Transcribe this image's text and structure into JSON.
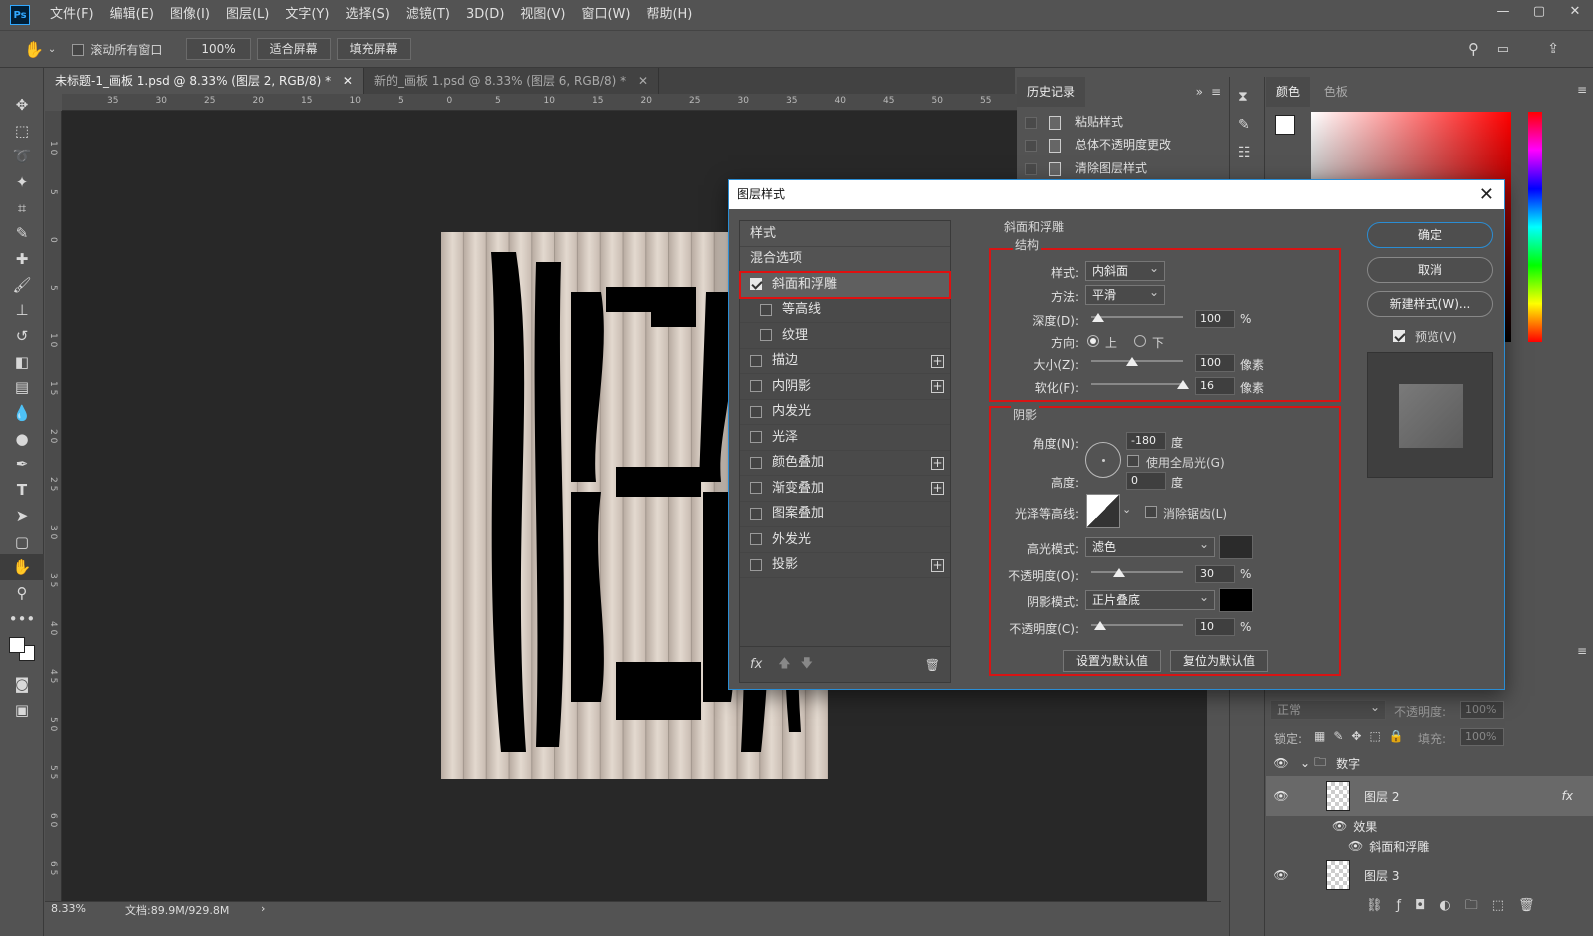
{
  "menubar": {
    "logo": "Ps",
    "items": [
      "文件(F)",
      "编辑(E)",
      "图像(I)",
      "图层(L)",
      "文字(Y)",
      "选择(S)",
      "滤镜(T)",
      "3D(D)",
      "视图(V)",
      "窗口(W)",
      "帮助(H)"
    ]
  },
  "options": {
    "scroll_all": "滚动所有窗口",
    "zoom": "100%",
    "fit_screen": "适合屏幕",
    "fill_screen": "填充屏幕"
  },
  "tabs": [
    {
      "label": "未标题-1_画板 1.psd @ 8.33% (图层 2, RGB/8) *"
    },
    {
      "label": "新的_画板 1.psd @ 8.33% (图层 6, RGB/8) *"
    }
  ],
  "ruler": {
    "h": [
      "35",
      "30",
      "25",
      "20",
      "15",
      "10",
      "5",
      "0",
      "5",
      "10",
      "15",
      "20",
      "25",
      "30",
      "35",
      "40",
      "45",
      "50",
      "55"
    ],
    "v": [
      "1 0",
      "5",
      "0",
      "5",
      "1 0",
      "1 5",
      "2 0",
      "2 5",
      "3 0",
      "3 5",
      "4 0",
      "4 5",
      "5 0",
      "5 5",
      "6 0",
      "6 5"
    ]
  },
  "status": {
    "zoom": "8.33%",
    "doc": "文档:89.9M/929.8M"
  },
  "history": {
    "tab": "历史记录",
    "rows": [
      "粘贴样式",
      "总体不透明度更改",
      "清除图层样式"
    ]
  },
  "color_panel": {
    "tab_color": "颜色",
    "tab_swatch": "色板"
  },
  "layers": {
    "blend": "正常",
    "opacity_label": "不透明度:",
    "opacity": "100%",
    "lock_label": "锁定:",
    "fill_label": "填充:",
    "fill": "100%",
    "group": "数字",
    "layer2": "图层 2",
    "effects": "效果",
    "bevel": "斜面和浮雕",
    "layer3": "图层 3"
  },
  "dialog": {
    "title": "图层样式",
    "styles": [
      {
        "label": "样式",
        "type": "header"
      },
      {
        "label": "混合选项",
        "type": "header"
      },
      {
        "label": "斜面和浮雕",
        "checked": true,
        "selected": true
      },
      {
        "label": "等高线",
        "checked": false,
        "sub": true
      },
      {
        "label": "纹理",
        "checked": false,
        "sub": true
      },
      {
        "label": "描边",
        "checked": false,
        "plus": true
      },
      {
        "label": "内阴影",
        "checked": false,
        "plus": true
      },
      {
        "label": "内发光",
        "checked": false
      },
      {
        "label": "光泽",
        "checked": false
      },
      {
        "label": "颜色叠加",
        "checked": false,
        "plus": true
      },
      {
        "label": "渐变叠加",
        "checked": false,
        "plus": true
      },
      {
        "label": "图案叠加",
        "checked": false
      },
      {
        "label": "外发光",
        "checked": false
      },
      {
        "label": "投影",
        "checked": false,
        "plus": true
      }
    ],
    "section_title": "斜面和浮雕",
    "structure": "结构",
    "style_label": "样式:",
    "style_value": "内斜面",
    "method_label": "方法:",
    "method_value": "平滑",
    "depth_label": "深度(D):",
    "depth_value": "100",
    "depth_frac": 0.08,
    "pct": "%",
    "direction_label": "方向:",
    "dir_up": "上",
    "dir_down": "下",
    "size_label": "大小(Z):",
    "size_value": "100",
    "size_frac": 0.45,
    "pixels": "像素",
    "soften_label": "软化(F):",
    "soften_value": "16",
    "soften_frac": 1.0,
    "shading": "阴影",
    "angle_label": "角度(N):",
    "angle_value": "-180",
    "deg": "度",
    "global_light": "使用全局光(G)",
    "altitude_label": "高度:",
    "altitude_value": "0",
    "gloss_label": "光泽等高线:",
    "antialias": "消除锯齿(L)",
    "highlight_label": "高光模式:",
    "highlight_value": "滤色",
    "hl_opacity_label": "不透明度(O):",
    "hl_opacity_value": "30",
    "hl_opacity_frac": 0.3,
    "shadow_label": "阴影模式:",
    "shadow_value": "正片叠底",
    "sh_opacity_label": "不透明度(C):",
    "sh_opacity_value": "10",
    "sh_opacity_frac": 0.1,
    "set_default": "设置为默认值",
    "reset_default": "复位为默认值",
    "ok": "确定",
    "cancel": "取消",
    "new_style": "新建样式(W)...",
    "preview": "预览(V)",
    "fx": "fx",
    "highlight_color": "#2b2b2b",
    "shadow_color": "#000000"
  }
}
